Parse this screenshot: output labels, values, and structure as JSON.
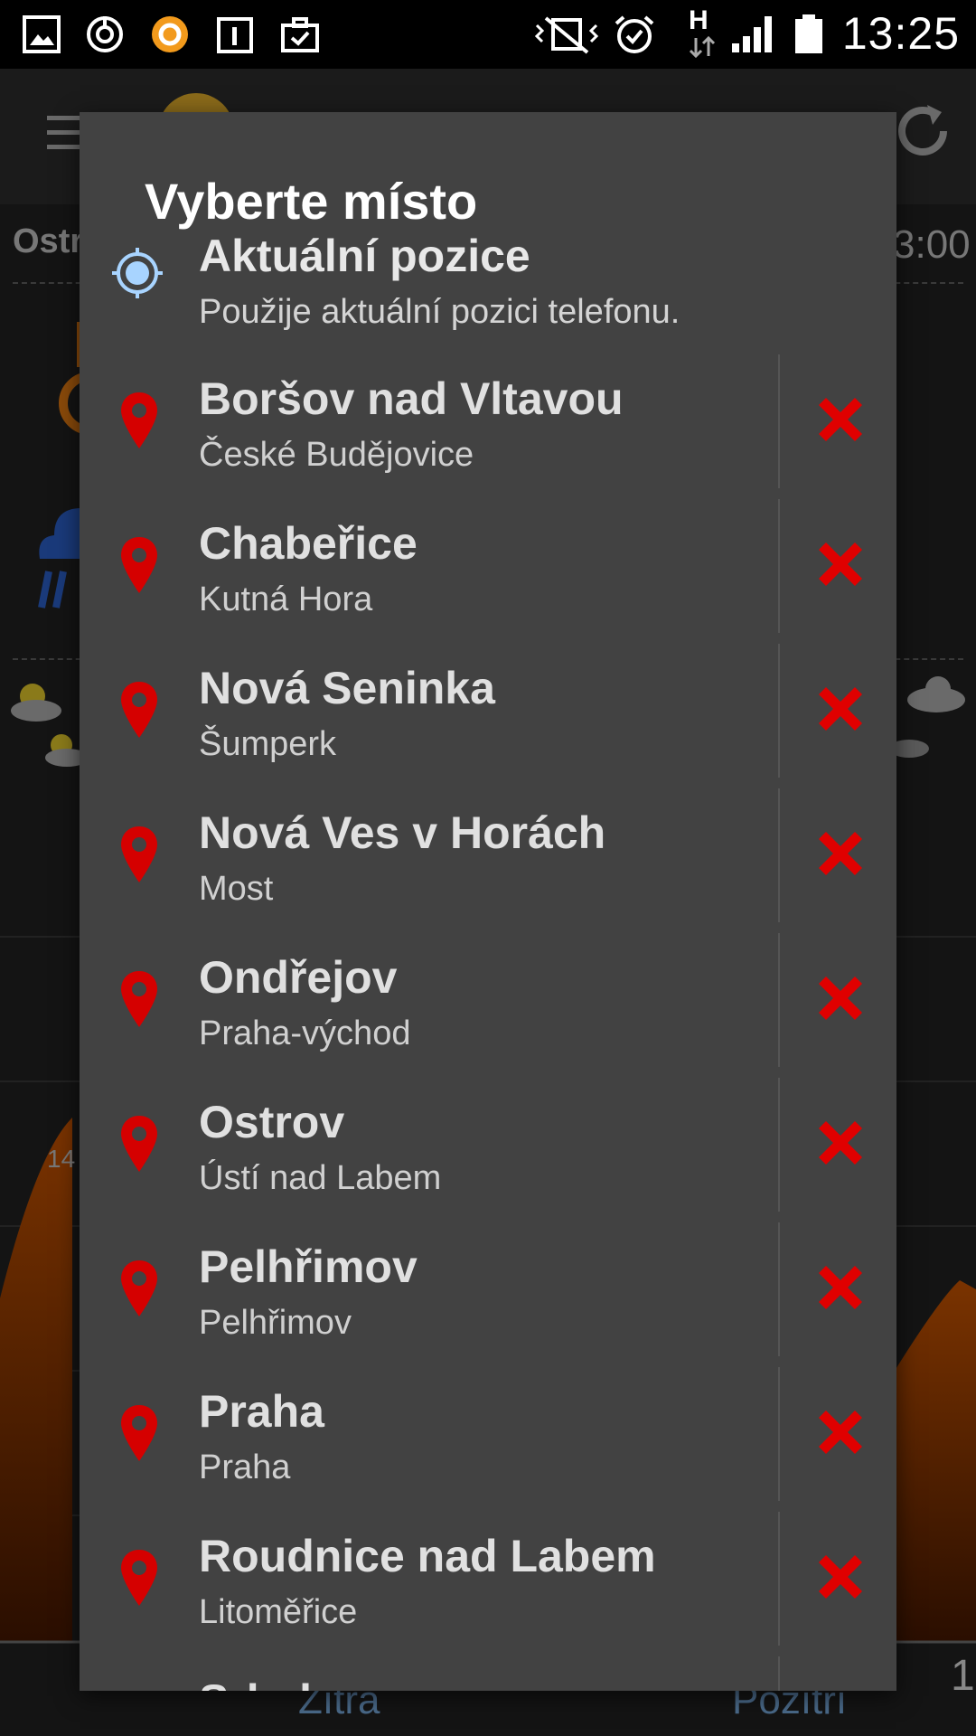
{
  "statusbar": {
    "time": "13:25",
    "network_label": "H"
  },
  "background": {
    "location_partial": "Ostr",
    "time_partial": "3:00",
    "scale_value": "14",
    "scale_value_right": "1",
    "footer_left": "Zítra",
    "footer_right": "Pozítří"
  },
  "dialog": {
    "title": "Vyberte místo",
    "current_location": {
      "title": "Aktuální pozice",
      "subtitle": "Použije aktuální pozici telefonu."
    },
    "items": [
      {
        "name": "Boršov nad Vltavou",
        "region": "České Budějovice"
      },
      {
        "name": "Chabeřice",
        "region": "Kutná Hora"
      },
      {
        "name": "Nová Seninka",
        "region": "Šumperk"
      },
      {
        "name": "Nová Ves v Horách",
        "region": "Most"
      },
      {
        "name": "Ondřejov",
        "region": "Praha-východ"
      },
      {
        "name": "Ostrov",
        "region": "Ústí nad Labem"
      },
      {
        "name": "Pelhřimov",
        "region": "Pelhřimov"
      },
      {
        "name": "Praha",
        "region": "Praha"
      },
      {
        "name": "Roudnice nad Labem",
        "region": "Litoměřice"
      }
    ],
    "peek_item_partial": "Srbsko"
  },
  "colors": {
    "dialog_bg": "#424242",
    "pin_red": "#d50000",
    "delete_red": "#e00000",
    "locate_blue": "#a8d4ff"
  }
}
